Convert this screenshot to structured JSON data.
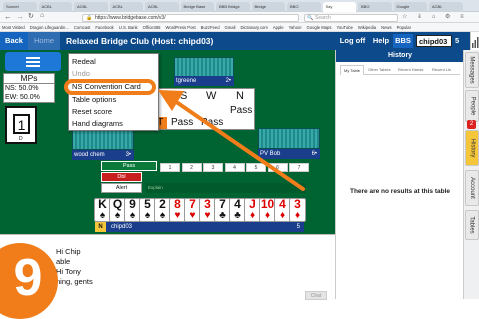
{
  "browser": {
    "tabs": [
      "Sonnet",
      "ACBL",
      "ACBL",
      "ACBL",
      "ACBL",
      "Bridge Base",
      "BBB Bridge",
      "Bridge",
      "BBO",
      "Say",
      "BBO",
      "Google",
      "ACBL"
    ],
    "url": "https://www.bridgebase.com/v3/",
    "search_placeholder": "Search",
    "bookmarks": [
      "Most Visited",
      "Dragon Lifeguardin...",
      "Comcast",
      "Facebook",
      "U.S. Bank",
      "Office365",
      "WordPress Post",
      "BuzzFeed",
      "Gmail",
      "Dictionary.com",
      "Apple",
      "Yahoo!",
      "Google Maps",
      "YouTube",
      "Wikipedia",
      "News",
      "Popular"
    ]
  },
  "app": {
    "back": "Back",
    "home": "Home",
    "title": "Relaxed Bridge Club (Host: chipd03)",
    "logoff": "Log off",
    "help": "Help",
    "bbs": "BBS",
    "username": "chipd03",
    "count": "5"
  },
  "left_panel": {
    "mps": "MPs",
    "ns": "NS: 50.0%",
    "ew": "EW: 50.0%",
    "board_number": "1",
    "board_dealer": "D"
  },
  "menu": {
    "items": [
      "Redeal",
      "Undo",
      "NS Convention Card",
      "Table options",
      "Reset score",
      "Hand diagrams"
    ]
  },
  "players": {
    "north_name": "tgreene",
    "north_tricks": "2•",
    "west_name": "wood chem",
    "west_tricks": "3•",
    "east_name": "PV Bob",
    "east_tricks": "6•",
    "south_name": "chipd03",
    "south_tricks": "5",
    "south_seat": "N"
  },
  "auction": {
    "headers": [
      "E",
      "S",
      "W",
      "N"
    ],
    "row1_last": "Pass",
    "row2": [
      "NT",
      "Pass",
      "Pass"
    ]
  },
  "bidbox": {
    "levels": [
      "1",
      "2",
      "3",
      "4",
      "5",
      "6",
      "7"
    ],
    "pass": "Pass",
    "dbl": "Dbl",
    "alert": "Alert",
    "explain": "Explain"
  },
  "hand": [
    {
      "rank": "K",
      "suit": "♠",
      "color": "blk"
    },
    {
      "rank": "Q",
      "suit": "♠",
      "color": "blk"
    },
    {
      "rank": "9",
      "suit": "♠",
      "color": "blk"
    },
    {
      "rank": "5",
      "suit": "♠",
      "color": "blk"
    },
    {
      "rank": "2",
      "suit": "♠",
      "color": "blk"
    },
    {
      "rank": "8",
      "suit": "♥",
      "color": "red"
    },
    {
      "rank": "7",
      "suit": "♥",
      "color": "red"
    },
    {
      "rank": "3",
      "suit": "♥",
      "color": "red"
    },
    {
      "rank": "7",
      "suit": "♣",
      "color": "blk"
    },
    {
      "rank": "4",
      "suit": "♣",
      "color": "blk"
    },
    {
      "rank": "J",
      "suit": "♦",
      "color": "red"
    },
    {
      "rank": "10",
      "suit": "♦",
      "color": "red"
    },
    {
      "rank": "4",
      "suit": "♦",
      "color": "red"
    },
    {
      "rank": "3",
      "suit": "♦",
      "color": "red"
    }
  ],
  "chat": {
    "lines": [
      "Hi Chip",
      "able",
      "Hi Tony",
      "ning, gents"
    ],
    "send": "Chat"
  },
  "overlay_number": "9",
  "history": {
    "title": "History",
    "tabs": [
      "My Table",
      "Other Tables",
      "Recent Hands",
      "Recent Lis"
    ],
    "empty": "There are no results at this table"
  },
  "vertical_tabs": [
    "Messages",
    "People",
    "History",
    "Account",
    "Tables"
  ],
  "people_badge": "2",
  "colors": {
    "felt": "#006432",
    "appbar": "#0d4a8b",
    "highlight": "#f07d1a",
    "history_tab": "#f6c63a"
  }
}
